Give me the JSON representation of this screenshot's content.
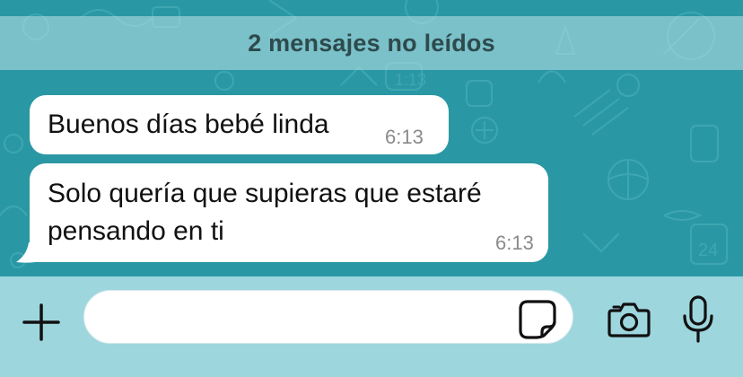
{
  "banner": {
    "unread_text": "2 mensajes no leídos"
  },
  "messages": [
    {
      "text": "Buenos días bebé linda",
      "time": "6:13"
    },
    {
      "text": "Solo quería que supieras que estaré pensando en ti",
      "time": "6:13"
    }
  ],
  "composer": {
    "input_value": "",
    "icons": [
      "plus-icon",
      "sticker-icon",
      "camera-icon",
      "microphone-icon"
    ]
  },
  "colors": {
    "chat_background": "#2a98a4",
    "banner": "#bce4e8",
    "bubble": "#ffffff",
    "input_bar": "#9ed6de",
    "icon": "#111111"
  }
}
